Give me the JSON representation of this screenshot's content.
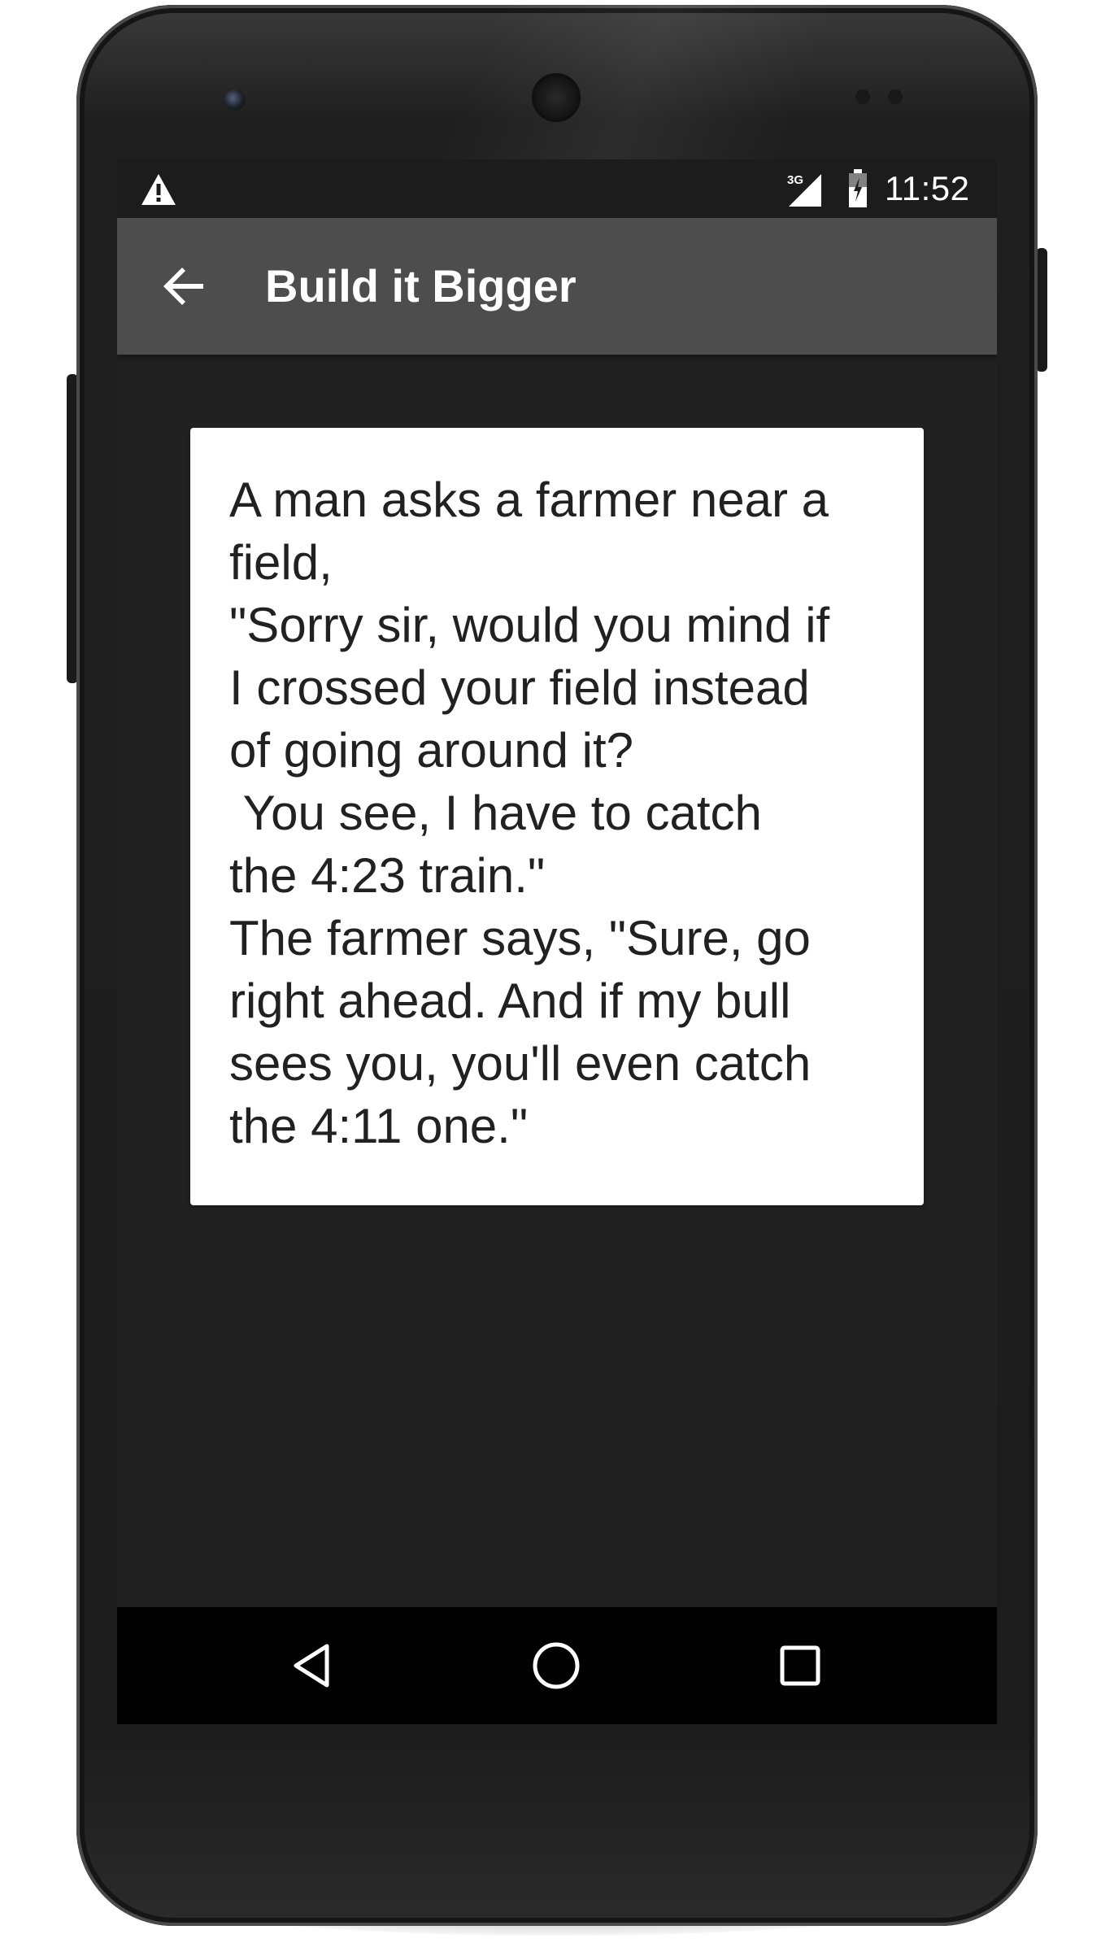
{
  "status_bar": {
    "network_type": "3G",
    "time": "11:52"
  },
  "app_bar": {
    "title": "Build it Bigger"
  },
  "joke": {
    "text": "A man asks a farmer near a\nfield,\n\"Sorry sir, would you mind if\nI crossed your field instead\nof going around it?\n You see, I have to catch\nthe 4:23 train.\"\nThe farmer says, \"Sure, go\nright ahead. And if my bull\nsees you, you'll even catch\nthe 4:11 one.\""
  },
  "icons": {
    "warning": "warning-icon",
    "signal": "signal-icon",
    "battery": "battery-icon",
    "back_arrow": "arrow-back-icon",
    "nav_back": "nav-back-triangle-icon",
    "nav_home": "nav-home-circle-icon",
    "nav_recents": "nav-recents-square-icon"
  },
  "colors": {
    "screen_background": "#212121",
    "app_bar": "#4d4d4d",
    "status_bar": "#1c1c1c",
    "card": "#ffffff",
    "text_on_card": "#212121",
    "nav_bar": "#000000"
  }
}
